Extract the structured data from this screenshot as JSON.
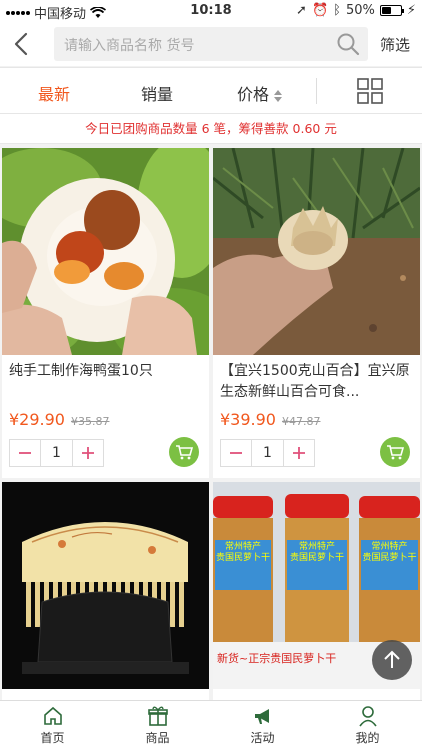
{
  "status": {
    "carrier": "中国移动",
    "time": "10:18",
    "battery": "50%",
    "battery_level": 0.5
  },
  "search": {
    "placeholder": "请输入商品名称 货号",
    "filter_label": "筛选"
  },
  "tabs": {
    "newest": "最新",
    "sales": "销量",
    "price": "价格"
  },
  "banner": "今日已团购商品数量 6 笔，筹得善款 0.60 元",
  "products": [
    {
      "name": "纯手工制作海鸭蛋10只",
      "price": "¥29.90",
      "old_price": "¥35.87",
      "qty": "1",
      "image": "salted-duck-egg"
    },
    {
      "name": "【宜兴1500克山百合】宜兴原生态新鲜山百合可食...",
      "price": "¥39.90",
      "old_price": "¥47.87",
      "qty": "1",
      "image": "lily-bulb"
    },
    {
      "name": "",
      "price": "",
      "old_price": "",
      "qty": "",
      "image": "wooden-comb"
    },
    {
      "name": "",
      "price": "",
      "old_price": "",
      "qty": "",
      "image": "dried-radish-jars"
    }
  ],
  "jar_labels": {
    "top": "常州特产",
    "sub": "贵国民萝卜干",
    "bottom": "新货~正宗贵国民萝卜干"
  },
  "tabbar": {
    "home": "首页",
    "goods": "商品",
    "activity": "活动",
    "mine": "我的"
  },
  "colors": {
    "accent": "#f1581e",
    "banner_text": "#e03131",
    "cart_green": "#7cc043",
    "tabbar_active": "#2e6b3b"
  }
}
